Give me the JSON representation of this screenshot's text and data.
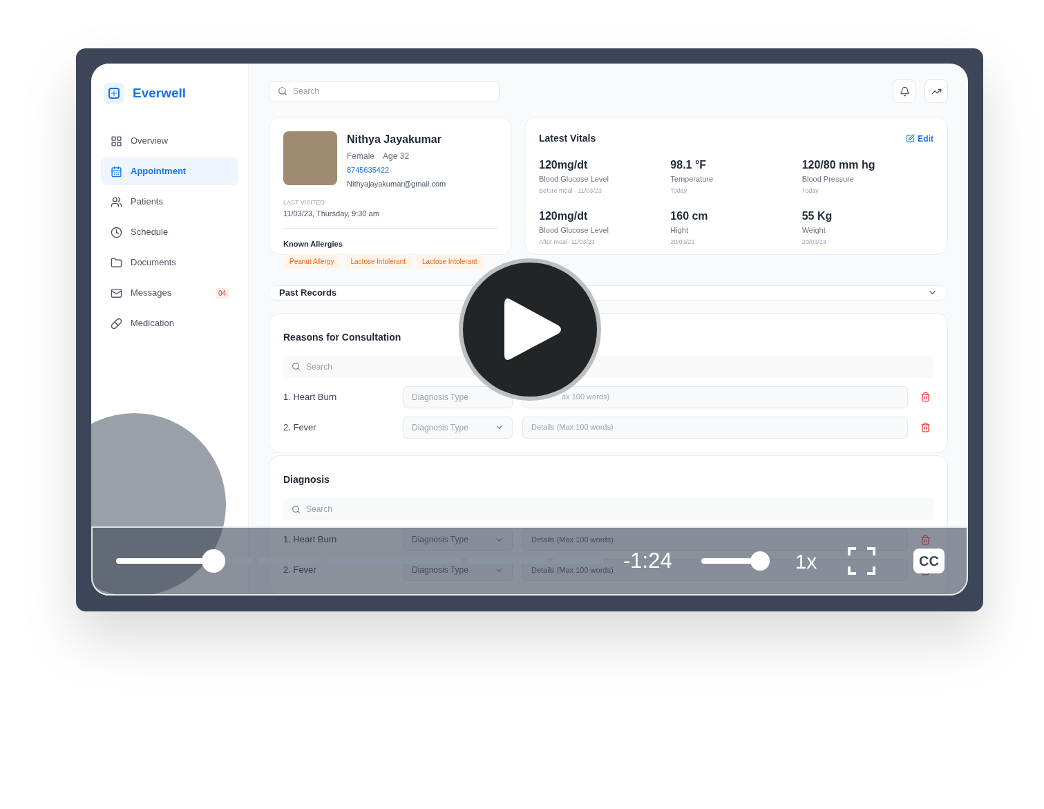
{
  "brand": {
    "name": "Everwell"
  },
  "nav": [
    {
      "label": "Overview",
      "selected": false
    },
    {
      "label": "Appointment",
      "selected": true
    },
    {
      "label": "Patients",
      "selected": false
    },
    {
      "label": "Schedule",
      "selected": false
    },
    {
      "label": "Documents",
      "selected": false
    },
    {
      "label": "Messages",
      "selected": false,
      "badge": "04"
    },
    {
      "label": "Medication",
      "selected": false
    }
  ],
  "search": {
    "placeholder": "Search"
  },
  "patient": {
    "name": "Nithya Jayakumar",
    "gender": "Female",
    "age": "Age 32",
    "phone": "8745635422",
    "email": "Nithyajayakumar@gmail.com",
    "last_visited_label": "LAST VISITED",
    "last_visited": "11/03/23, Thursday, 9:30 am",
    "allergies_title": "Known Allergies",
    "allergies": [
      "Peanut Allergy",
      "Lactose Intolerant",
      "Lactose Intolerant"
    ]
  },
  "vitals": {
    "title": "Latest Vitals",
    "edit": "Edit",
    "items": [
      {
        "value": "120mg/dt",
        "label": "Blood Glucose Level",
        "note": "Before meal - 11/03/23"
      },
      {
        "value": "98.1 °F",
        "label": "Temperature",
        "note": "Today"
      },
      {
        "value": "120/80 mm hg",
        "label": "Blood Pressure",
        "note": "Today"
      },
      {
        "value": "120mg/dt",
        "label": "Blood Glucose Level",
        "note": "After meal- 11/03/23"
      },
      {
        "value": "160 cm",
        "label": "Hight",
        "note": "20/03/23"
      },
      {
        "value": "55 Kg",
        "label": "Weight",
        "note": "20/03/23"
      }
    ]
  },
  "past_records": {
    "title": "Past Records",
    "expanded": false
  },
  "consultation": {
    "title": "Reasons for Consultation",
    "search_placeholder": "Search",
    "rows": [
      {
        "name": "1. Heart Burn",
        "type_placeholder": "Diagnosis Type",
        "details_placeholder": "ax 100 words)"
      },
      {
        "name": "2. Fever",
        "type_placeholder": "Diagnosis Type",
        "details_placeholder": "Details (Max 100 words)"
      }
    ]
  },
  "diagnosis": {
    "title": "Diagnosis",
    "search_placeholder": "Search",
    "rows": [
      {
        "name": "1. Heart Burn",
        "type_placeholder": "Diagnosis Type",
        "details_placeholder": "Details (Max 100 words)"
      },
      {
        "name": "2. Fever",
        "type_placeholder": "Diagnosis Type",
        "details_placeholder": "Details (Max 100 words)"
      }
    ]
  },
  "player": {
    "progress": {
      "level": 0.2
    },
    "time": "-1:24",
    "volume": {
      "level": 0.87
    },
    "speed": "1x",
    "captions": "CC"
  }
}
